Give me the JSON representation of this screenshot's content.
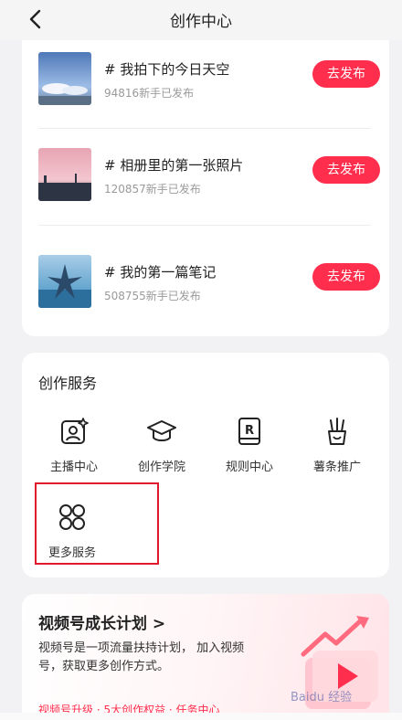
{
  "header": {
    "title": "创作中心",
    "back_icon": "chevron-left-icon"
  },
  "tasks": [
    {
      "name": "# 我拍下的今日天空",
      "count": "94816新手已发布",
      "button": "去发布",
      "thumb": "sky-photo"
    },
    {
      "name": "# 相册里的第一张照片",
      "count": "120857新手已发布",
      "button": "去发布",
      "thumb": "pink-sky-photo"
    },
    {
      "name": "# 我的第一篇笔记",
      "count": "508755新手已发布",
      "button": "去发布",
      "thumb": "starfish-photo"
    }
  ],
  "services": {
    "title": "创作服务",
    "items": [
      {
        "label": "主播中心",
        "icon": "streamer-icon"
      },
      {
        "label": "创作学院",
        "icon": "graduation-cap-icon"
      },
      {
        "label": "规则中心",
        "icon": "rules-book-icon"
      },
      {
        "label": "薯条推广",
        "icon": "fries-icon"
      },
      {
        "label": "更多服务",
        "icon": "four-circles-icon"
      }
    ]
  },
  "growth": {
    "title": "视频号成长计划 >",
    "description": "视频号是一项流量扶持计划， 加入视频号，获取更多创作方式。",
    "links": "视频号升级 · 5大创作权益 · 任务中心"
  },
  "watermark": "Baidu 经验",
  "colors": {
    "accent": "#ff2e4d",
    "highlight": "#e0192d",
    "background": "#f2f2f4"
  }
}
